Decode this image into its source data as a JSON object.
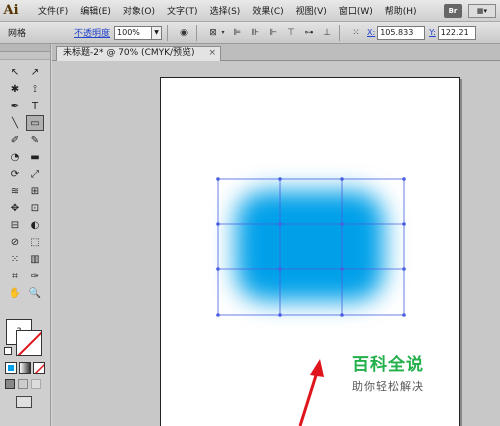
{
  "app": {
    "logo": "Ai"
  },
  "menu": [
    "文件(F)",
    "编辑(E)",
    "对象(O)",
    "文字(T)",
    "选择(S)",
    "效果(C)",
    "视图(V)",
    "窗口(W)",
    "帮助(H)"
  ],
  "menu_right": {
    "bridge": "Br",
    "workspace": "▦▾"
  },
  "control": {
    "object_type": "网格",
    "opacity_label": "不透明度",
    "opacity_value": "100%",
    "x_label": "X:",
    "x_value": "105.833",
    "y_label": "Y:",
    "y_value": "122.21"
  },
  "document": {
    "tab_title": "未标题-2* @ 70% (CMYK/预览)",
    "close": "×"
  },
  "tools": [
    "↖",
    "↗",
    "✱",
    "⟟",
    "✒",
    "T",
    "╲",
    "▭",
    "✐",
    "✎",
    "◔",
    "▬",
    "⟳",
    "⤢",
    "≋",
    "⊞",
    "✥",
    "⊡",
    "⊟",
    "◐",
    "⊘",
    "⬚",
    "⁙",
    "▥",
    "⌗",
    "✑",
    "✋",
    "🔍"
  ],
  "watermark": {
    "title": "百科全说",
    "subtitle": "助你轻松解决"
  },
  "colors": {
    "blob": "#00a0e9",
    "mesh": "#4a5fe0",
    "arrow": "#e0141c"
  }
}
